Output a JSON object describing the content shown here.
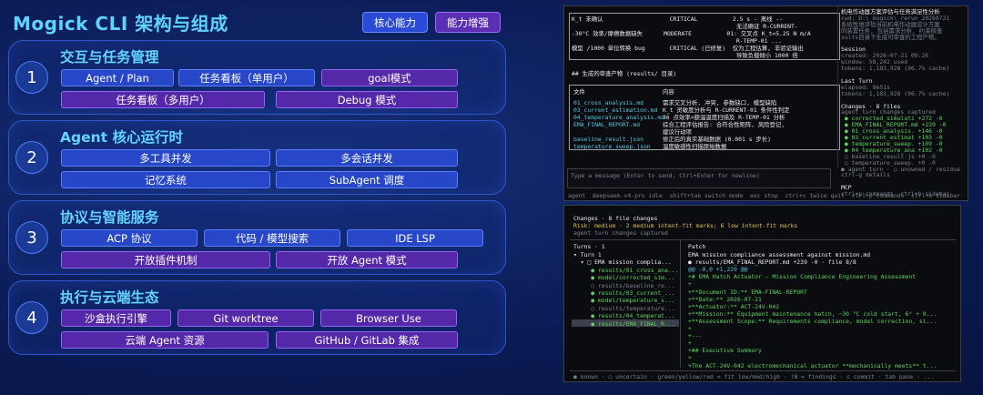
{
  "header": {
    "title": "Mogick CLI 架构与组成",
    "legend_core": "核心能力",
    "legend_adv": "能力增强"
  },
  "sections": [
    {
      "num": "1",
      "title": "交互与任务管理",
      "items": [
        {
          "label": "Agent / Plan",
          "kind": "core"
        },
        {
          "label": "任务看板（单用户）",
          "kind": "core"
        },
        {
          "label": "goal模式",
          "kind": "adv"
        },
        {
          "label": "任务看板（多用户）",
          "kind": "adv"
        },
        {
          "label": "Debug 模式",
          "kind": "adv"
        }
      ]
    },
    {
      "num": "2",
      "title": "Agent 核心运行时",
      "items": [
        {
          "label": "多工具并发",
          "kind": "core"
        },
        {
          "label": "多会话并发",
          "kind": "core"
        },
        {
          "label": "记忆系统",
          "kind": "core"
        },
        {
          "label": "SubAgent 调度",
          "kind": "core"
        }
      ]
    },
    {
      "num": "3",
      "title": "协议与智能服务",
      "items": [
        {
          "label": "ACP 协议",
          "kind": "core"
        },
        {
          "label": "代码 / 模型搜索",
          "kind": "core"
        },
        {
          "label": "IDE LSP",
          "kind": "core"
        },
        {
          "label": "开放插件机制",
          "kind": "adv"
        },
        {
          "label": "开放 Agent 模式",
          "kind": "adv"
        }
      ]
    },
    {
      "num": "4",
      "title": "执行与云端生态",
      "items": [
        {
          "label": "沙盒执行引擎",
          "kind": "adv"
        },
        {
          "label": "Git worktree",
          "kind": "adv"
        },
        {
          "label": "Browser Use",
          "kind": "adv"
        },
        {
          "label": "云端 Agent 资源",
          "kind": "adv"
        },
        {
          "label": "GitHub / GitLab 集成",
          "kind": "adv"
        }
      ]
    }
  ],
  "term1": {
    "table": [
      "K_t 未确认                   CRITICAL          2.5 s - 离线 --",
      "                                               无法确证 R-CURRENT-",
      "-30°C 效率/摩擦数据缺失      MODERATE          01: 交叉点 K_t=5.25 N m/A",
      "                                               R-TEMP-01 ...",
      "模型 /1000 单位转换 bug       CRITICAL (已修复)  仅为工程估算, 非验证输出",
      "                                               导致负载倾小 1000 倍"
    ],
    "section_title": "## 生成的审查产物 (results/ 目录)",
    "files_header": [
      "文件",
      "内容"
    ],
    "files": [
      [
        "01_cross_analysis.md",
        "需求交叉分析, 冲突, 参数缺口, 模型缺陷"
      ],
      [
        "03_current_estimation.md",
        "K_t 灵敏度分析与 R-CURRENT-01 条件性判定"
      ],
      [
        "04_temperature_analysis.md",
        "36 点效率×额温温度扫描及 R-TEMP-01 分析"
      ],
      [
        "EMA_FINAL_REPORT.md",
        "综合工程评估报告: 合符合性矩阵, 风险登记,"
      ],
      [
        "",
        "建议行动项"
      ],
      [
        "baseline_result.json",
        "修正后的真实基础数据 (0.001 s 步长)"
      ],
      [
        "temperature_sweep.json",
        "温度敏感性扫描原始数据"
      ]
    ],
    "input_placeholder": "Type a message (Enter to send, Ctrl+Enter for newline)",
    "status": "agent  deepseek-v4-pro idle  shift+tab switch mode  esc stop  ctrl+c twice quit  ctrl+p commands  ctrl+b sidebar  ctrl+...",
    "side": [
      "机电作动器方案评估与任务满足性分析",
      "cwd: D:\\_mogick\\_rerun_20260721",
      "系统性地评估当前机电作动器设计方案",
      "的装置任务, 包括需求分析, 约束核查",
      "sults目录下生成可审查的工程产物。",
      "",
      "Session",
      "created: 2026-07-21 09:26",
      "window: 58,242 used",
      "tokens: 1,183,928 (96.7% cache)",
      "",
      "Last Turn",
      "elapsed: 9m51s",
      "tokens: 1,183,928 (96.7% cache)",
      "",
      "Changes · 8 files",
      "agent turn changes captured",
      " ● corrected_simulati +272 -0",
      " ● EMA_FINAL_REPORT.md +239 -0",
      " ● 01_cross_analysis. +146 -0",
      " ● 03_current_estimat +103 -0",
      " ● temperature_sweep. +109 -0",
      " ● 04_temperature_ana +102 -0",
      " ○ baseline_result.js +0 -0",
      " ○ temperature_sweep. +0 -0",
      "● agent turn · ○ unowned / residua",
      "ctrl-g details",
      "",
      "MCP",
      "ctrl+p commands  ctrl+b sidebar"
    ]
  },
  "term2": {
    "header": "Changes · 8 file changes",
    "risk": "Risk: medium · 2 medium intent-fit marks; 6 low intent-fit marks",
    "captured": "agent turn changes captured",
    "turns_title": "Turns · 1",
    "turns": [
      "▾ Turn 1",
      "  ▾ □ EMA mission complia...",
      "     ● results/01_cross_ana...",
      "     ● model/corrected_sim...",
      "     ○ results/baseline_re...",
      "     ● results/03_current_...",
      "     ● model/temperature_s...",
      "     ○ results/temperature...",
      "     ● results/04_temperat...",
      "     ● results/EMA_FINAL_R..."
    ],
    "patch_title": "Patch",
    "patch": [
      "EMA mission compliance assessment against mission.md",
      "● results/EMA_FINAL_REPORT.md +239 -0 · file 8/8",
      "@@ -0,0 +1,239 @@",
      "+# EMA Hatch Actuator — Mission Compliance Engineering Assessment",
      "+",
      "+**Document ID:** EMA-FINAL-REPORT",
      "+**Date:** 2026-07-21",
      "+**Actuator:** ACT-24V-042",
      "+**Mission:** Equipment maintenance hatch, −30 °C cold start, 6° + 9...",
      "+**Assessment Scope:** Requirements compliance, model correction, si...",
      "+",
      "+---",
      "+",
      "+## Executive Summary",
      "+",
      "+The ACT-24V-042 electromechanical actuator **mechanically meets** t..."
    ],
    "footer": "● known · ○ uncertain · green/yellow/red = fit low/med/high · !N = findings · c commit · tab pane · ..."
  }
}
